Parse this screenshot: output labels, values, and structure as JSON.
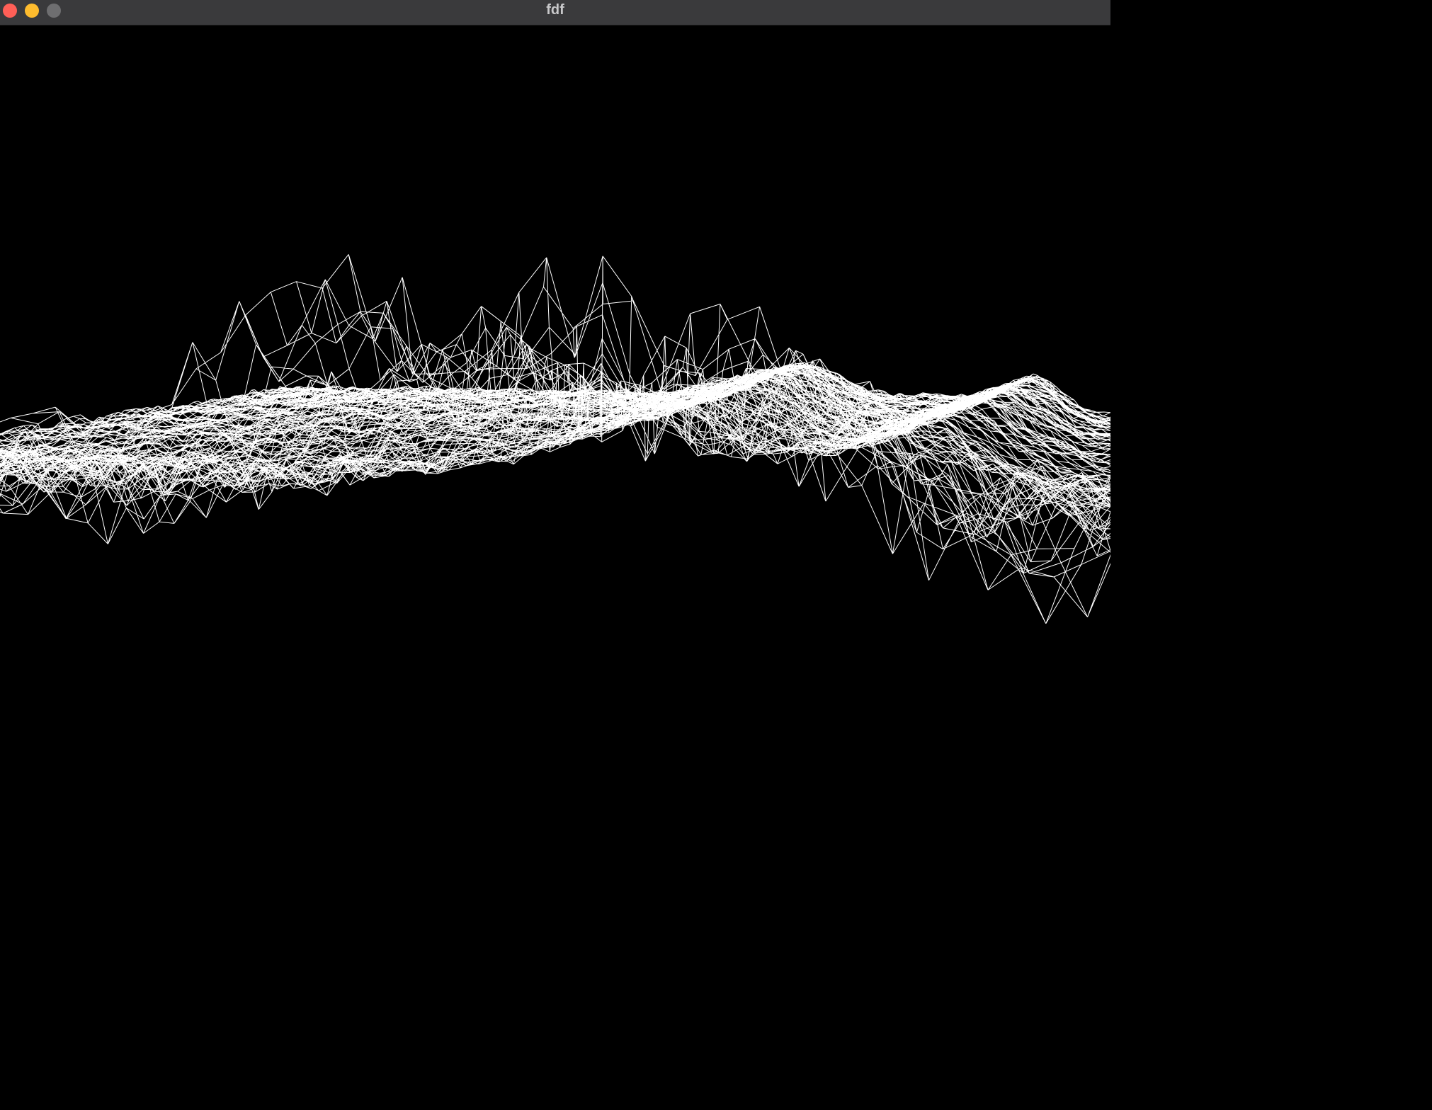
{
  "window": {
    "title": "fdf",
    "buttons": {
      "close": "#ff5f57",
      "minimize": "#febc2e",
      "zoom": "#6e6e70"
    }
  },
  "render": {
    "background": "#000000",
    "wire_color": "#ffffff",
    "mesh": "wireframe-terrain-heightmap"
  }
}
